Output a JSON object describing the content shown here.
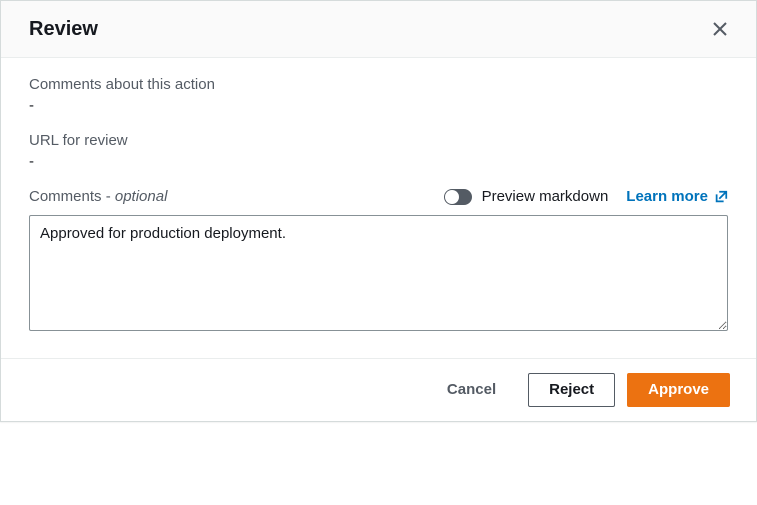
{
  "dialog": {
    "title": "Review"
  },
  "fields": {
    "comments_about_action": {
      "label": "Comments about this action",
      "value": "-"
    },
    "url_for_review": {
      "label": "URL for review",
      "value": "-"
    }
  },
  "comments_input": {
    "label_main": "Comments",
    "label_sep": " - ",
    "label_optional": "optional",
    "preview_toggle_label": "Preview markdown",
    "preview_toggle_on": false,
    "learn_more_label": "Learn more",
    "value": "Approved for production deployment."
  },
  "footer": {
    "cancel": "Cancel",
    "reject": "Reject",
    "approve": "Approve"
  }
}
